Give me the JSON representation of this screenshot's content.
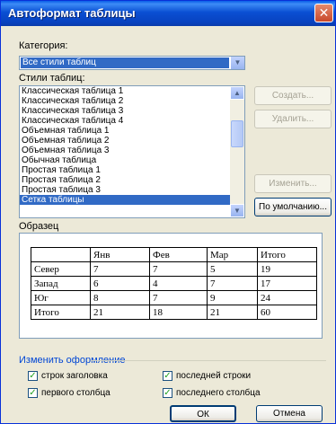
{
  "window": {
    "title": "Автоформат таблицы",
    "close_label": "✕"
  },
  "category": {
    "label": "Категория:",
    "selected": "Все стили таблиц"
  },
  "styles": {
    "label": "Стили таблиц:",
    "items": [
      "Классическая таблица 1",
      "Классическая таблица 2",
      "Классическая таблица 3",
      "Классическая таблица 4",
      "Объемная таблица 1",
      "Объемная таблица 2",
      "Объемная таблица 3",
      "Обычная таблица",
      "Простая таблица 1",
      "Простая таблица 2",
      "Простая таблица 3",
      "Сетка таблицы"
    ],
    "selected_index": 11
  },
  "buttons": {
    "create": "Создать...",
    "delete": "Удалить...",
    "modify": "Изменить...",
    "default": "По умолчанию...",
    "ok": "ОК",
    "cancel": "Отмена"
  },
  "preview": {
    "label": "Образец",
    "header": [
      "",
      "Янв",
      "Фев",
      "Мар",
      "Итого"
    ],
    "rows": [
      [
        "Север",
        "7",
        "7",
        "5",
        "19"
      ],
      [
        "Запад",
        "6",
        "4",
        "7",
        "17"
      ],
      [
        "Юг",
        "8",
        "7",
        "9",
        "24"
      ],
      [
        "Итого",
        "21",
        "18",
        "21",
        "60"
      ]
    ]
  },
  "apply": {
    "label": "Изменить оформление",
    "header_rows": "строк заголовка",
    "first_column": "первого столбца",
    "last_row": "последней строки",
    "last_column": "последнего столбца",
    "all_checked": true
  },
  "colors": {
    "titlebar": "#0A4FD3",
    "dialog_bg": "#ECE9D8",
    "selection": "#316AC5",
    "check": "#21A121"
  }
}
